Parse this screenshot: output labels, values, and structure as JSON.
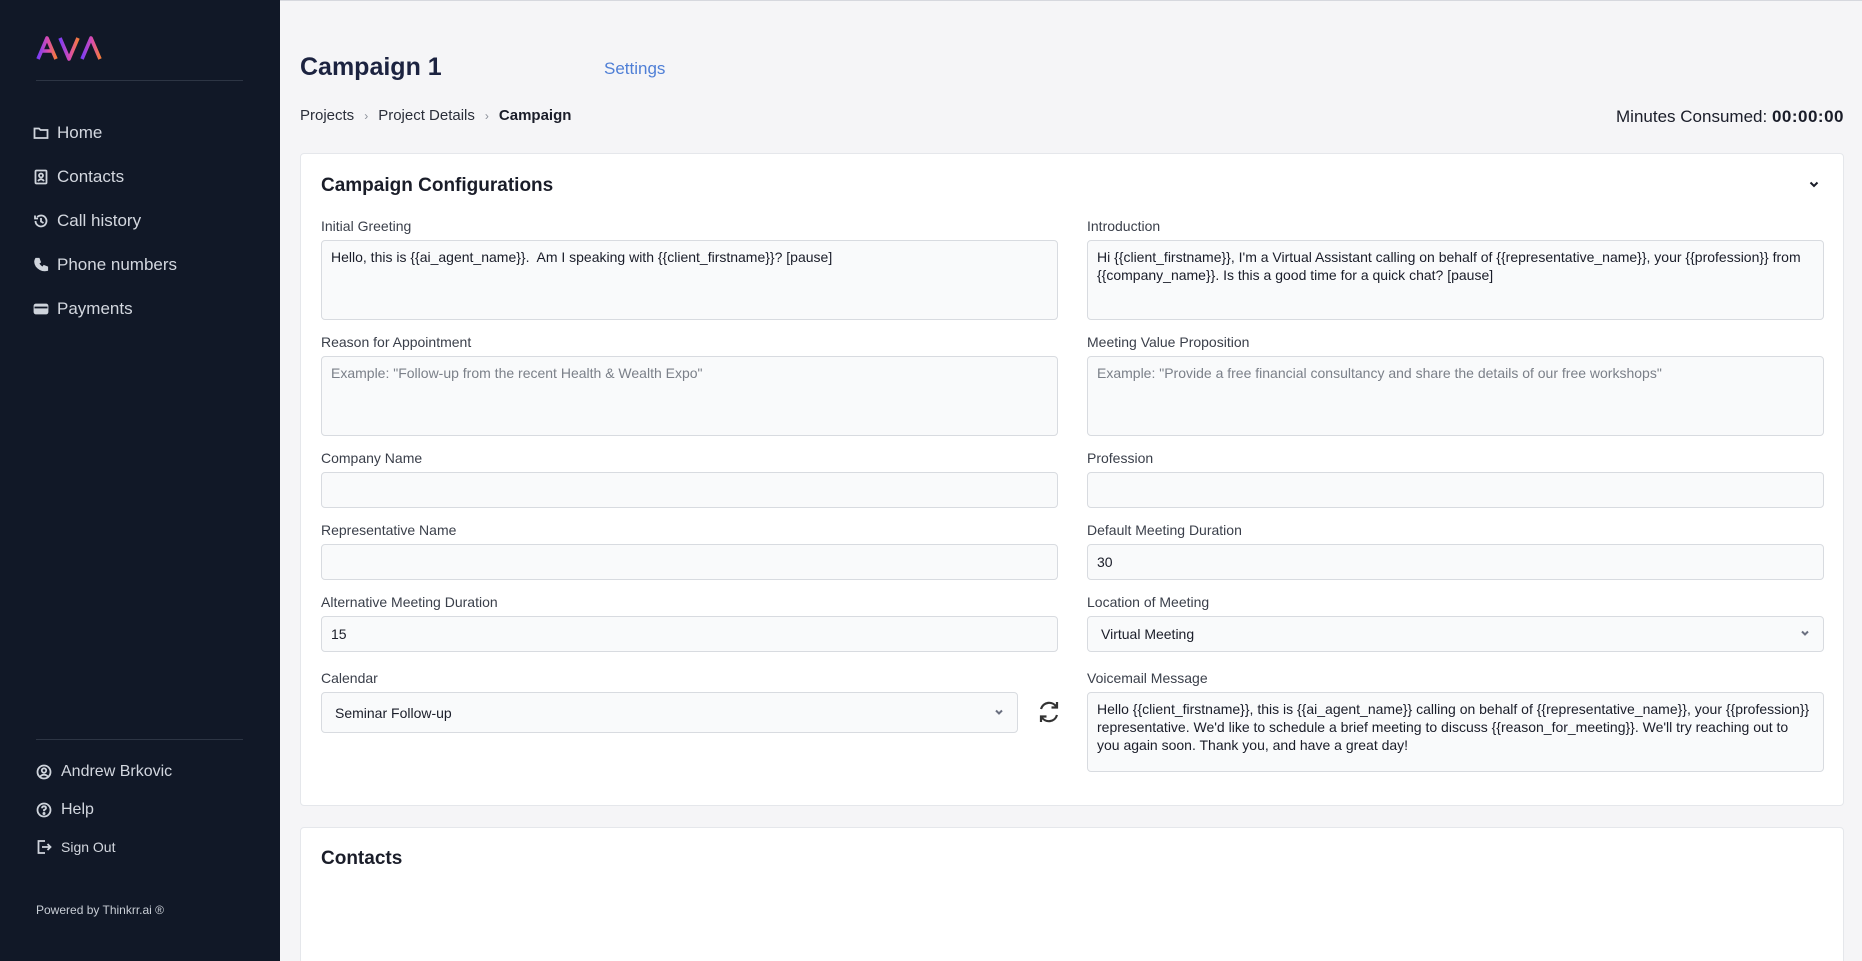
{
  "brand": {
    "logo_text": "AVA"
  },
  "sidebar": {
    "items": [
      {
        "label": "Home",
        "icon": "folder-icon"
      },
      {
        "label": "Contacts",
        "icon": "contact-card-icon"
      },
      {
        "label": "Call history",
        "icon": "history-icon"
      },
      {
        "label": "Phone numbers",
        "icon": "phone-icon"
      },
      {
        "label": "Payments",
        "icon": "credit-card-icon"
      }
    ],
    "footer": {
      "user": "Andrew Brkovic",
      "help": "Help",
      "signout": "Sign Out",
      "powered": "Powered by Thinkrr.ai ®"
    }
  },
  "header": {
    "title": "Campaign 1",
    "settings": "Settings",
    "breadcrumb": [
      "Projects",
      "Project Details",
      "Campaign"
    ],
    "minutes_label": "Minutes Consumed:",
    "minutes_value": "00:00:00"
  },
  "config": {
    "title": "Campaign Configurations",
    "initial_greeting": {
      "label": "Initial Greeting",
      "value": "Hello, this is {{ai_agent_name}}.  Am I speaking with {{client_firstname}}? [pause]"
    },
    "introduction": {
      "label": "Introduction",
      "value": "Hi {{client_firstname}}, I'm a Virtual Assistant calling on behalf of {{representative_name}}, your {{profession}} from {{company_name}}. Is this a good time for a quick chat? [pause]"
    },
    "reason": {
      "label": "Reason for Appointment",
      "placeholder": "Example: \"Follow-up from the recent Health & Wealth Expo\""
    },
    "value_prop": {
      "label": "Meeting Value Proposition",
      "placeholder": "Example: \"Provide a free financial consultancy and share the details of our free workshops\""
    },
    "company_name": {
      "label": "Company Name",
      "value": ""
    },
    "profession": {
      "label": "Profession",
      "value": ""
    },
    "representative_name": {
      "label": "Representative Name",
      "value": ""
    },
    "default_duration": {
      "label": "Default Meeting Duration",
      "value": "30"
    },
    "alt_duration": {
      "label": "Alternative Meeting Duration",
      "value": "15"
    },
    "location": {
      "label": "Location of Meeting",
      "value": "Virtual Meeting"
    },
    "calendar": {
      "label": "Calendar",
      "value": "Seminar Follow-up"
    },
    "voicemail": {
      "label": "Voicemail Message",
      "value": "Hello {{client_firstname}}, this is {{ai_agent_name}} calling on behalf of {{representative_name}}, your {{profession}} representative. We'd like to schedule a brief meeting to discuss {{reason_for_meeting}}. We'll try reaching out to you again soon. Thank you, and have a great day!"
    }
  },
  "contacts": {
    "title": "Contacts"
  },
  "colors": {
    "sidebar_bg": "#111827",
    "accent_link": "#4f7fd6",
    "page_bg": "#f5f5f7"
  }
}
